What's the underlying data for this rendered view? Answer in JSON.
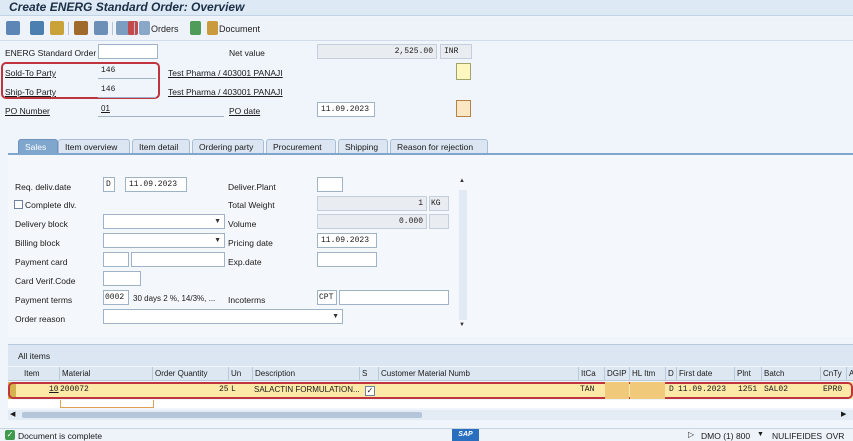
{
  "title": "Create ENERG Standard Order: Overview",
  "toolbar": {
    "orders_label": "Orders",
    "document_label": "Document"
  },
  "header": {
    "order_type_label": "ENERG Standard Order",
    "order_number": "",
    "net_value_label": "Net value",
    "net_value": "2,525.00",
    "currency": "INR",
    "sold_to_label": "Sold-To Party",
    "sold_to_value": "146",
    "sold_to_name": "Test Pharma / 403001 PANAJI",
    "ship_to_label": "Ship-To Party",
    "ship_to_value": "146",
    "ship_to_name": "Test Pharma / 403001 PANAJI",
    "po_number_label": "PO Number",
    "po_number_value": "01",
    "po_date_label": "PO date",
    "po_date_value": "11.09.2023"
  },
  "tabs": [
    "Sales",
    "Item overview",
    "Item detail",
    "Ordering party",
    "Procurement",
    "Shipping",
    "Reason for rejection"
  ],
  "sales": {
    "req_deliv_date_label": "Req. deliv.date",
    "req_deliv_date_type": "D",
    "req_deliv_date": "11.09.2023",
    "complete_dlv_label": "Complete dlv.",
    "delivery_block_label": "Delivery block",
    "billing_block_label": "Billing block",
    "payment_card_label": "Payment card",
    "card_verif_label": "Card Verif.Code",
    "payment_terms_label": "Payment terms",
    "payment_terms_code": "0002",
    "payment_terms_text": "30 days 2 %, 14/3%, ...",
    "order_reason_label": "Order reason",
    "deliver_plant_label": "Deliver.Plant",
    "total_weight_label": "Total Weight",
    "total_weight": "1",
    "weight_unit": "KG",
    "volume_label": "Volume",
    "volume": "0.000",
    "pricing_date_label": "Pricing date",
    "pricing_date": "11.09.2023",
    "exp_date_label": "Exp.date",
    "incoterms_label": "Incoterms",
    "incoterms_code": "CPT"
  },
  "items": {
    "section_label": "All items",
    "columns": [
      "Item",
      "Material",
      "Order Quantity",
      "Un",
      "Description",
      "S",
      "Customer Material Numb",
      "ItCa",
      "DGIP",
      "HL Itm",
      "D",
      "First date",
      "Plnt",
      "Batch",
      "CnTy",
      "A"
    ],
    "rows": [
      {
        "item": "10",
        "material": "200072",
        "qty": "25",
        "un": "L",
        "description": "SALACTIN FORMULATION...",
        "s": "✓",
        "cust_mat": "",
        "itca": "TAN",
        "dgip": "",
        "hl_itm": "",
        "d": "D",
        "first_date": "11.09.2023",
        "plnt": "1251",
        "batch": "SAL02",
        "cnty": "EPR0"
      }
    ]
  },
  "status": {
    "message": "Document is complete",
    "system": "DMO (1) 800",
    "user": "NULIFEIDES",
    "mode": "OVR",
    "logo": "SAP"
  }
}
